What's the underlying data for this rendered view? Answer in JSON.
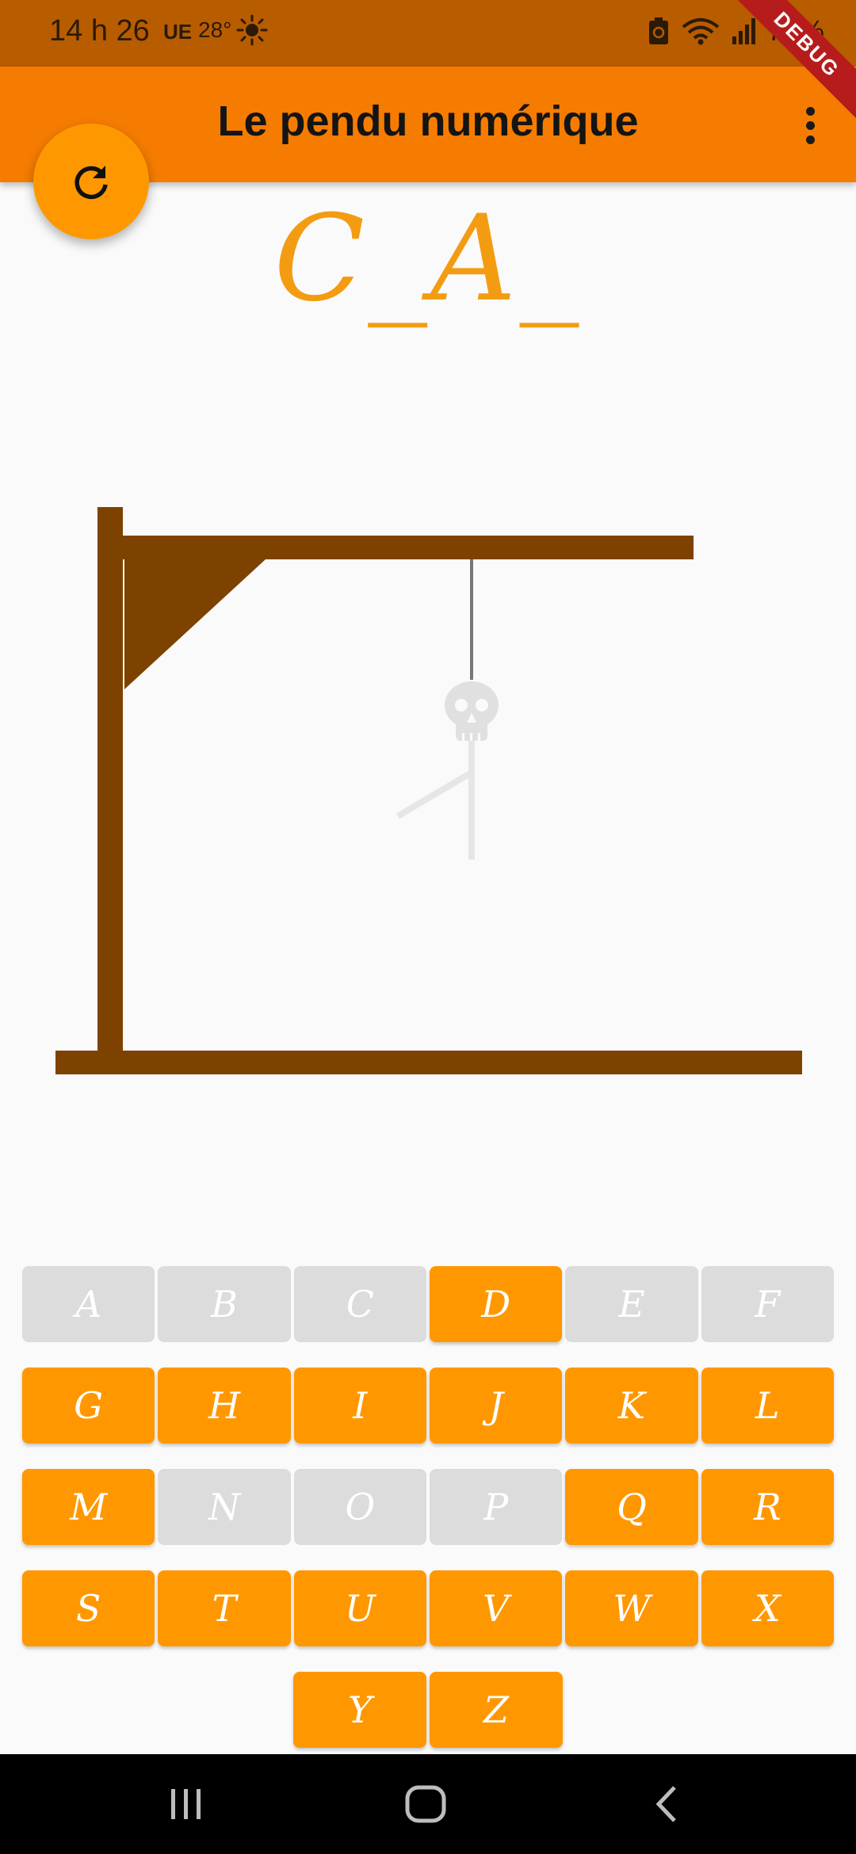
{
  "status_bar": {
    "time": "14 h 26",
    "carrier": "UE",
    "temperature": "28°",
    "battery": "79%"
  },
  "debug_banner": "DEBUG",
  "app_bar": {
    "title": "Le pendu numérique"
  },
  "game": {
    "word": "C_A_"
  },
  "keyboard": {
    "rows": [
      [
        {
          "letter": "A",
          "used": true
        },
        {
          "letter": "B",
          "used": true
        },
        {
          "letter": "C",
          "used": true
        },
        {
          "letter": "D",
          "used": false
        },
        {
          "letter": "E",
          "used": true
        },
        {
          "letter": "F",
          "used": true
        }
      ],
      [
        {
          "letter": "G",
          "used": false
        },
        {
          "letter": "H",
          "used": false
        },
        {
          "letter": "I",
          "used": false
        },
        {
          "letter": "J",
          "used": false
        },
        {
          "letter": "K",
          "used": false
        },
        {
          "letter": "L",
          "used": false
        }
      ],
      [
        {
          "letter": "M",
          "used": false
        },
        {
          "letter": "N",
          "used": true
        },
        {
          "letter": "O",
          "used": true
        },
        {
          "letter": "P",
          "used": true
        },
        {
          "letter": "Q",
          "used": false
        },
        {
          "letter": "R",
          "used": false
        }
      ],
      [
        {
          "letter": "S",
          "used": false
        },
        {
          "letter": "T",
          "used": false
        },
        {
          "letter": "U",
          "used": false
        },
        {
          "letter": "V",
          "used": false
        },
        {
          "letter": "W",
          "used": false
        },
        {
          "letter": "X",
          "used": false
        }
      ],
      [
        {
          "letter": "Y",
          "used": false
        },
        {
          "letter": "Z",
          "used": false
        }
      ]
    ]
  },
  "colors": {
    "status_bar": "#b85c00",
    "app_bar": "#f57c00",
    "accent": "#ff9800",
    "word": "#f39c12",
    "gallows": "#7d4200",
    "used_key": "#dcdcdc"
  },
  "icons": {
    "fab": "refresh-icon",
    "menu": "more-vert-icon",
    "nav_recents": "recents-icon",
    "nav_home": "home-icon",
    "nav_back": "back-icon"
  }
}
